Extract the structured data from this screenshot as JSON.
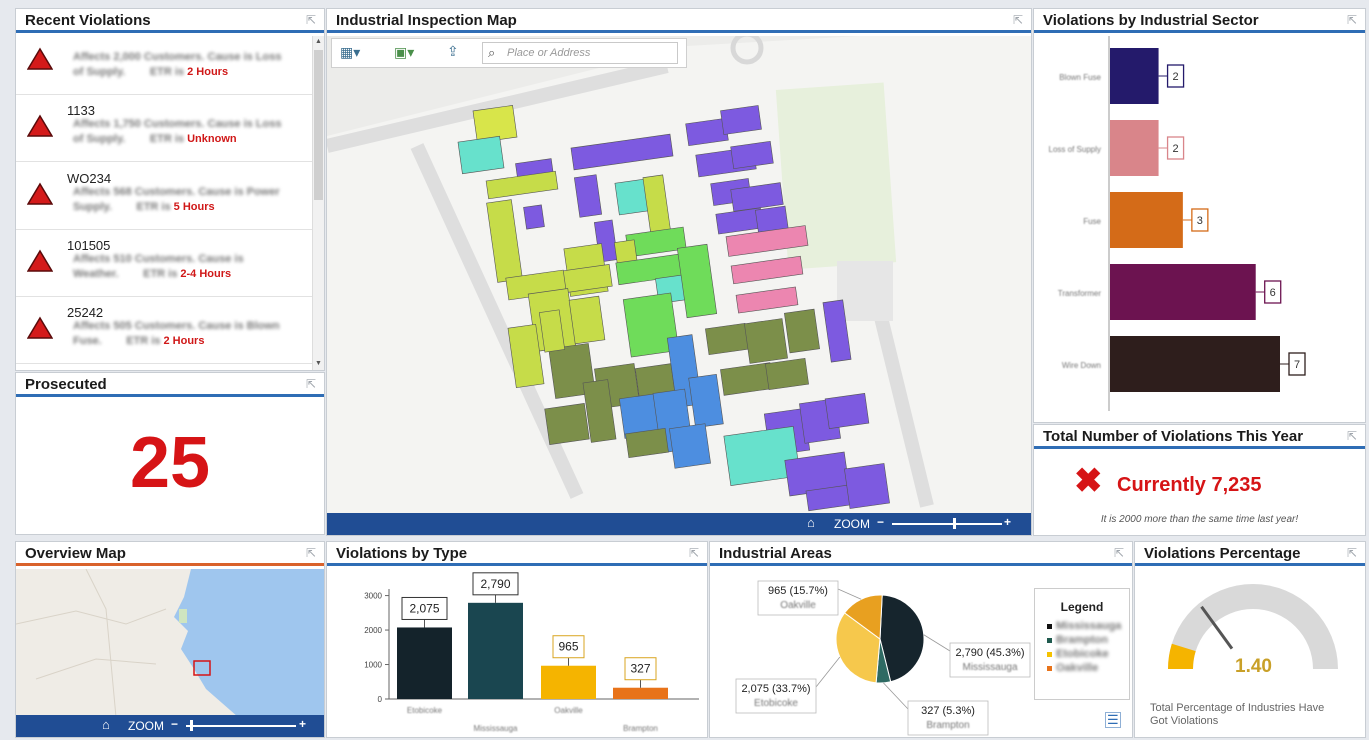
{
  "recent": {
    "title": "Recent Violations",
    "items": [
      {
        "id": "",
        "l1": "Affects 2,000 Customers. Cause is Loss",
        "l2": "of Supply.",
        "eta": "ETR is",
        "val": "2 Hours"
      },
      {
        "id": "1133",
        "l1": "Affects 1,750 Customers. Cause is Loss",
        "l2": "of Supply.",
        "eta": "ETR is",
        "val": "Unknown"
      },
      {
        "id": "WO234",
        "l1": "Affects 568 Customers. Cause is Power",
        "l2": "Supply.",
        "eta": "ETR is",
        "val": "5 Hours"
      },
      {
        "id": "101505",
        "l1": "Affects 510 Customers. Cause is",
        "l2": "Weather.",
        "eta": "ETR is",
        "val": "2-4 Hours"
      },
      {
        "id": "25242",
        "l1": "Affects 505 Customers. Cause is Blown",
        "l2": "Fuse.",
        "eta": "ETR is",
        "val": "2 Hours"
      }
    ]
  },
  "prosecuted": {
    "title": "Prosecuted",
    "value": "25"
  },
  "map": {
    "title": "Industrial Inspection Map",
    "search_placeholder": "Place or Address",
    "zoom_label": "ZOOM"
  },
  "sector": {
    "title": "Violations by Industrial Sector"
  },
  "total": {
    "title": "Total Number of Violations This Year",
    "value": "Currently 7,235",
    "note": "It is 2000 more than the same time last year!"
  },
  "overview": {
    "title": "Overview Map",
    "zoom_label": "ZOOM"
  },
  "vtype": {
    "title": "Violations by Type"
  },
  "areas": {
    "title": "Industrial Areas",
    "legend_title": "Legend"
  },
  "percentage": {
    "title": "Violations Percentage",
    "value": "1.40",
    "caption": "Total Percentage of Industries Have Got Violations",
    "fraction": 0.06
  },
  "chart_data": [
    {
      "type": "bar",
      "orientation": "horizontal",
      "categories": [
        "Blown Fuse",
        "Loss of Supply",
        "Fuse",
        "Transformer",
        "Wire Down"
      ],
      "values": [
        2,
        2,
        3,
        6,
        7
      ],
      "colors": [
        "#241a6b",
        "#d9858a",
        "#d46b18",
        "#6c1350",
        "#2e1e1c"
      ]
    },
    {
      "type": "bar",
      "categories": [
        "Etobicoke",
        "Mississauga",
        "Oakville",
        "Brampton"
      ],
      "values": [
        2075,
        2790,
        965,
        327
      ],
      "data_labels": [
        "2,075",
        "2,790",
        "965",
        "327"
      ],
      "yticks": [
        0,
        1000,
        2000,
        3000
      ],
      "ytick_labels": [
        "0",
        "1000",
        "2000",
        "3000"
      ],
      "ylim": [
        0,
        3000
      ],
      "colors": [
        "#14232b",
        "#1a4650",
        "#f5b400",
        "#e8731a"
      ]
    },
    {
      "type": "pie",
      "labels": [
        "Mississauga",
        "Etobicoke",
        "Oakville",
        "Brampton"
      ],
      "values": [
        2790,
        2075,
        965,
        327
      ],
      "data_labels": [
        "2,790 (45.3%)",
        "2,075 (33.7%)",
        "965 (15.7%)",
        "327 (5.3%)"
      ],
      "colors": [
        "#16252d",
        "#f6c84c",
        "#e8a020",
        "#2e6a63"
      ],
      "legend": [
        "Mississauga",
        "Brampton",
        "Etobicoke",
        "Oakville"
      ],
      "legend_colors": [
        "#111111",
        "#1f5a4e",
        "#f5c200",
        "#e8731a"
      ]
    }
  ]
}
